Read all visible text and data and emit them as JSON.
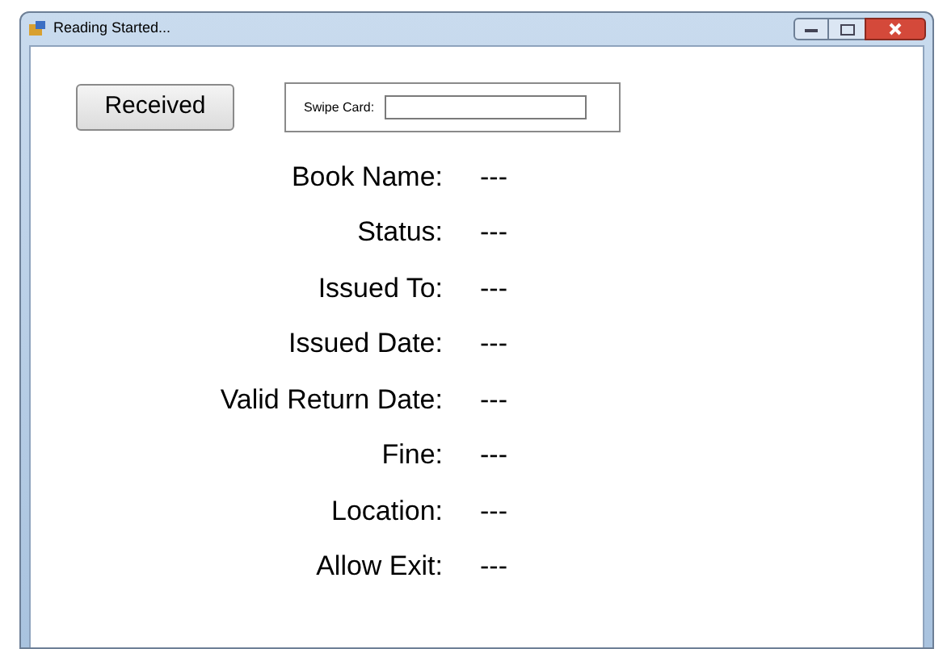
{
  "window": {
    "title": "Reading Started..."
  },
  "received_button": {
    "label": "Received"
  },
  "swipe_card": {
    "label": "Swipe Card:"
  },
  "fields": [
    {
      "label": "Book Name:",
      "value": "---"
    },
    {
      "label": "Status:",
      "value": "---"
    },
    {
      "label": "Issued To:",
      "value": "---"
    },
    {
      "label": "Issued Date:",
      "value": "---"
    },
    {
      "label": "Valid Return Date:",
      "value": "---"
    },
    {
      "label": "Fine:",
      "value": "---"
    },
    {
      "label": "Location:",
      "value": "---"
    },
    {
      "label": "Allow Exit:",
      "value": "---"
    }
  ]
}
